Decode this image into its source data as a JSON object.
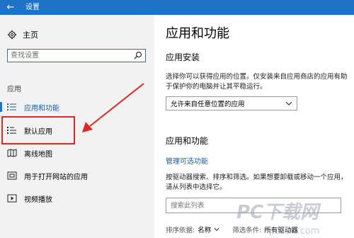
{
  "window": {
    "back_glyph": "←",
    "title": "设置"
  },
  "sidebar": {
    "home_label": "主页",
    "search_placeholder": "查找设置",
    "section_label": "应用",
    "items": [
      {
        "label": "应用和功能",
        "icon": "apps-list-icon",
        "active": true
      },
      {
        "label": "默认应用",
        "icon": "default-apps-icon",
        "active": false
      },
      {
        "label": "离线地图",
        "icon": "map-icon",
        "active": false
      },
      {
        "label": "用于打开网站的应用",
        "icon": "website-app-icon",
        "active": false
      },
      {
        "label": "视频播放",
        "icon": "video-icon",
        "active": false
      }
    ]
  },
  "main": {
    "title": "应用和功能",
    "install_heading": "应用安装",
    "install_desc": "选择你可以获得应用的位置。仅安装来自应用商店的应用有助于保护你的电脑并让其平稳运行。",
    "install_dropdown_value": "允许来自任意位置的应用",
    "apps_heading": "应用和功能",
    "manage_link": "管理可选功能",
    "apps_desc": "按驱动器搜索、排序和筛选。如果想要卸载或移动一个应用，请从列表中选择它。",
    "list_search_placeholder": "搜索此列表",
    "sort_label": "排序依据:",
    "sort_value": "名称",
    "filter_label": "筛选条件:",
    "filter_value": "所有驱动器"
  },
  "watermark": {
    "text": "PC下载网",
    "url_fragment": "pcsoft.com"
  },
  "colors": {
    "accent": "#1e73c8",
    "annotation": "#e02626",
    "sidebar_bg": "#f2f2f2"
  }
}
